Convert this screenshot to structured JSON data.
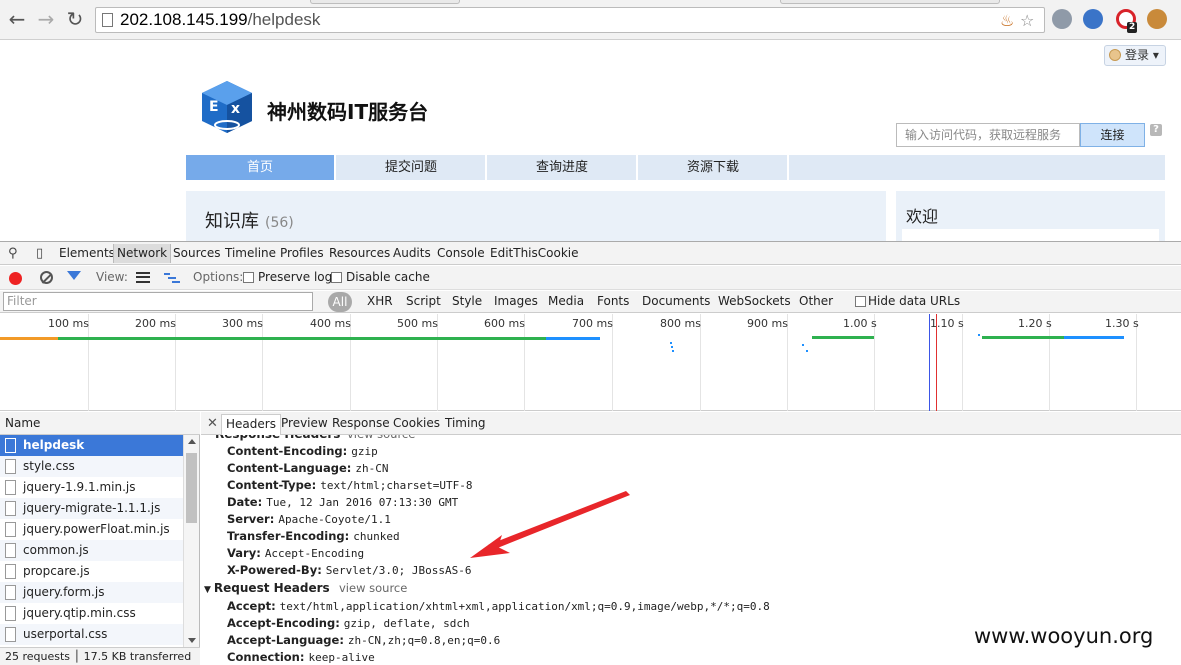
{
  "browser": {
    "url_host": "202.108.145.199",
    "url_path": "/helpdesk",
    "extension_badge": "2"
  },
  "site": {
    "login_label": "登录",
    "title": "神州数码IT服务台",
    "access_placeholder": "输入访问代码，获取远程服务",
    "connect_label": "连接",
    "help_label": "?",
    "nav": [
      "首页",
      "提交问题",
      "查询进度",
      "资源下载"
    ],
    "kb_title": "知识库",
    "kb_count": "(56)",
    "welcome_title": "欢迎"
  },
  "devtools": {
    "tabs": [
      "Elements",
      "Network",
      "Sources",
      "Timeline",
      "Profiles",
      "Resources",
      "Audits",
      "Console",
      "EditThisCookie"
    ],
    "active_tab": "Network",
    "view_label": "View:",
    "options_label": "Options:",
    "preserve_log": "Preserve log",
    "disable_cache": "Disable cache",
    "filter_placeholder": "Filter",
    "type_all": "All",
    "types": [
      "XHR",
      "Script",
      "Style",
      "Images",
      "Media",
      "Fonts",
      "Documents",
      "WebSockets",
      "Other"
    ],
    "hide_data_urls": "Hide data URLs",
    "ticks": [
      "100 ms",
      "200 ms",
      "300 ms",
      "400 ms",
      "500 ms",
      "600 ms",
      "700 ms",
      "800 ms",
      "900 ms",
      "1.00 s",
      "1.10 s",
      "1.20 s",
      "1.30 s"
    ],
    "name_column": "Name",
    "requests": [
      "helpdesk",
      "style.css",
      "jquery-1.9.1.min.js",
      "jquery-migrate-1.1.1.js",
      "jquery.powerFloat.min.js",
      "common.js",
      "propcare.js",
      "jquery.form.js",
      "jquery.qtip.min.css",
      "userportal.css"
    ],
    "status": "25 requests │ 17.5 KB transferred",
    "detail_tabs": [
      "Headers",
      "Preview",
      "Response",
      "Cookies",
      "Timing"
    ],
    "response_headers_title": "Response Headers",
    "view_source": "view source",
    "response_headers": [
      {
        "k": "Content-Encoding:",
        "v": "gzip"
      },
      {
        "k": "Content-Language:",
        "v": "zh-CN"
      },
      {
        "k": "Content-Type:",
        "v": "text/html;charset=UTF-8"
      },
      {
        "k": "Date:",
        "v": "Tue, 12 Jan 2016 07:13:30 GMT"
      },
      {
        "k": "Server:",
        "v": "Apache-Coyote/1.1"
      },
      {
        "k": "Transfer-Encoding:",
        "v": "chunked"
      },
      {
        "k": "Vary:",
        "v": "Accept-Encoding"
      },
      {
        "k": "X-Powered-By:",
        "v": "Servlet/3.0; JBossAS-6"
      }
    ],
    "request_headers_title": "Request Headers",
    "request_headers": [
      {
        "k": "Accept:",
        "v": "text/html,application/xhtml+xml,application/xml;q=0.9,image/webp,*/*;q=0.8"
      },
      {
        "k": "Accept-Encoding:",
        "v": "gzip, deflate, sdch"
      },
      {
        "k": "Accept-Language:",
        "v": "zh-CN,zh;q=0.8,en;q=0.6"
      },
      {
        "k": "Connection:",
        "v": "keep-alive"
      }
    ]
  },
  "watermark": "www.wooyun.org",
  "colors": {
    "accent": "#3b78d8",
    "nav_active": "#76aaea",
    "arrow": "#e8262a"
  }
}
